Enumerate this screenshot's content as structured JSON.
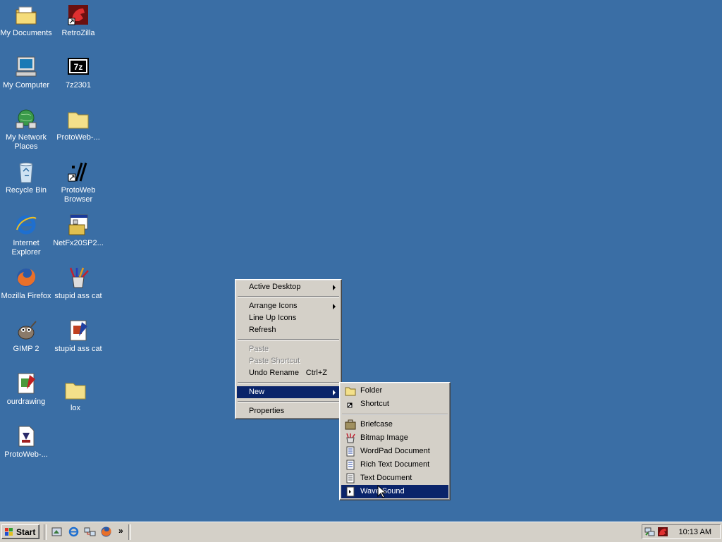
{
  "desktop": {
    "icons": [
      {
        "label": "My Documents",
        "icon": "my-documents-icon"
      },
      {
        "label": "RetroZilla",
        "icon": "retrozilla-icon"
      },
      {
        "label": "My Computer",
        "icon": "my-computer-icon"
      },
      {
        "label": "7z2301",
        "icon": "7zip-icon"
      },
      {
        "label": "My Network Places",
        "icon": "network-places-icon"
      },
      {
        "label": "ProtoWeb-...",
        "icon": "folder-icon"
      },
      {
        "label": "Recycle Bin",
        "icon": "recycle-bin-icon"
      },
      {
        "label": "ProtoWeb Browser",
        "icon": "protoweb-browser-icon"
      },
      {
        "label": "Internet Explorer",
        "icon": "internet-explorer-icon"
      },
      {
        "label": "NetFx20SP2...",
        "icon": "installer-icon"
      },
      {
        "label": "Mozilla Firefox",
        "icon": "firefox-icon"
      },
      {
        "label": "stupid ass cat",
        "icon": "paintbrush-cup-icon"
      },
      {
        "label": "GIMP 2",
        "icon": "gimp-icon"
      },
      {
        "label": "stupid ass cat",
        "icon": "drawing-file-icon"
      },
      {
        "label": "ourdrawing",
        "icon": "drawing-file-icon"
      },
      {
        "label": "lox",
        "icon": "folder-icon"
      },
      {
        "label": "ProtoWeb-...",
        "icon": "html-file-icon"
      }
    ]
  },
  "context_menu": {
    "active_desktop": "Active Desktop",
    "arrange_icons": "Arrange Icons",
    "line_up_icons": "Line Up Icons",
    "refresh": "Refresh",
    "paste": "Paste",
    "paste_shortcut": "Paste Shortcut",
    "undo_rename": "Undo Rename",
    "undo_rename_accel": "Ctrl+Z",
    "new": "New",
    "properties": "Properties"
  },
  "new_submenu": {
    "folder": "Folder",
    "shortcut": "Shortcut",
    "briefcase": "Briefcase",
    "bitmap_image": "Bitmap Image",
    "wordpad_document": "WordPad Document",
    "rich_text_document": "Rich Text Document",
    "text_document": "Text Document",
    "wave_sound": "Wave Sound"
  },
  "taskbar": {
    "start_label": "Start",
    "overflow": "»",
    "clock": "10:13 AM"
  },
  "colors": {
    "desktop": "#3a6ea5",
    "selection": "#0a246a",
    "chrome": "#d4d0c8"
  }
}
